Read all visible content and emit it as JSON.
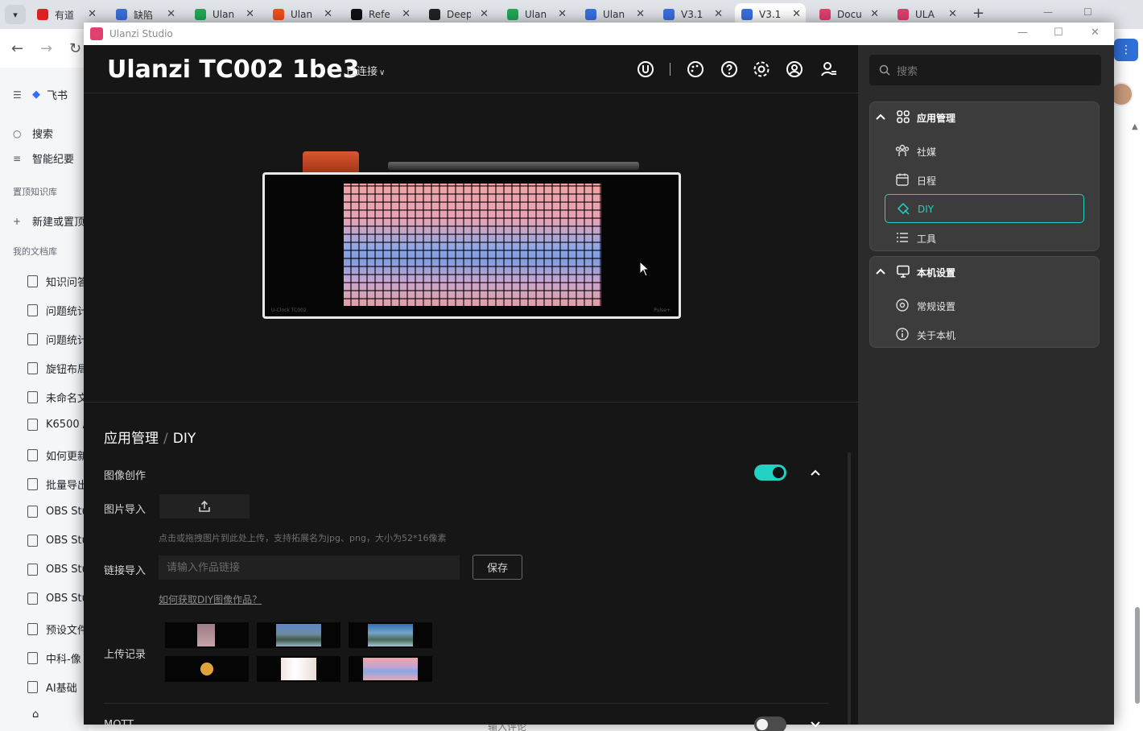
{
  "browser": {
    "tabs": [
      {
        "label": "有道",
        "color": "#e02020"
      },
      {
        "label": "缺陷",
        "color": "#3a6fe0"
      },
      {
        "label": "Ulan",
        "color": "#1fa855"
      },
      {
        "label": "Ulan",
        "color": "#f24e1e"
      },
      {
        "label": "Refe",
        "color": "#111111"
      },
      {
        "label": "Deep",
        "color": "#222222"
      },
      {
        "label": "Ulan",
        "color": "#1fa855"
      },
      {
        "label": "Ulan",
        "color": "#3a6fe0"
      },
      {
        "label": "V3.1",
        "color": "#3a6fe0"
      },
      {
        "label": "V3.1",
        "color": "#3a6fe0"
      },
      {
        "label": "Docu",
        "color": "#e0406e"
      },
      {
        "label": "ULA",
        "color": "#e0406e"
      }
    ],
    "active_tab_index": 9
  },
  "feishu": {
    "app_name": "飞书",
    "search": "搜索",
    "ai_minutes": "智能纪要",
    "pinned_section": "置顶知识库",
    "new_pinned": "新建或置顶",
    "my_docs_section": "我的文档库",
    "docs": [
      "知识问答",
      "问题统计",
      "问题统计",
      "旋钮布局",
      "未命名文",
      "K6500 /",
      "如何更新",
      "批量导出",
      "OBS Stu",
      "OBS Stu",
      "OBS Stu",
      "OBS Stu",
      "预设文件",
      "中科-像",
      "AI基础"
    ],
    "comment_placeholder": "输入评论"
  },
  "app": {
    "window_title": "Ulanzi Studio",
    "device_name": "Ulanzi TC002 1be3",
    "connection_status": "已连接",
    "device_caption_left": "U-Clock TC002",
    "device_caption_right": "Pulse+",
    "breadcrumb": {
      "parent": "应用管理",
      "separator": "/",
      "current": "DIY"
    },
    "image_creation": {
      "label": "图像创作",
      "enabled": true,
      "import_label": "图片导入",
      "upload_hint": "点击或拖拽图片到此处上传，支持拓展名为jpg、png，大小为52*16像素",
      "link_label": "链接导入",
      "link_placeholder": "请输入作品链接",
      "link_value": "",
      "save_label": "保存",
      "help_link": "如何获取DIY图像作品？",
      "history_label": "上传记录"
    },
    "mqtt": {
      "label": "MQTT",
      "enabled": false
    }
  },
  "sidebar": {
    "search_placeholder": "搜索",
    "groups": [
      {
        "title": "应用管理",
        "expanded": true,
        "items": [
          {
            "label": "社媒",
            "icon": "social-icon"
          },
          {
            "label": "日程",
            "icon": "calendar-icon"
          },
          {
            "label": "DIY",
            "icon": "diy-icon",
            "active": true
          },
          {
            "label": "工具",
            "icon": "tools-icon"
          }
        ]
      },
      {
        "title": "本机设置",
        "expanded": true,
        "items": [
          {
            "label": "常规设置",
            "icon": "settings-icon"
          },
          {
            "label": "关于本机",
            "icon": "info-icon"
          }
        ]
      }
    ]
  },
  "colors": {
    "accent": "#22d1c2",
    "background": "#161616",
    "sidebar": "#2b2b2b"
  }
}
